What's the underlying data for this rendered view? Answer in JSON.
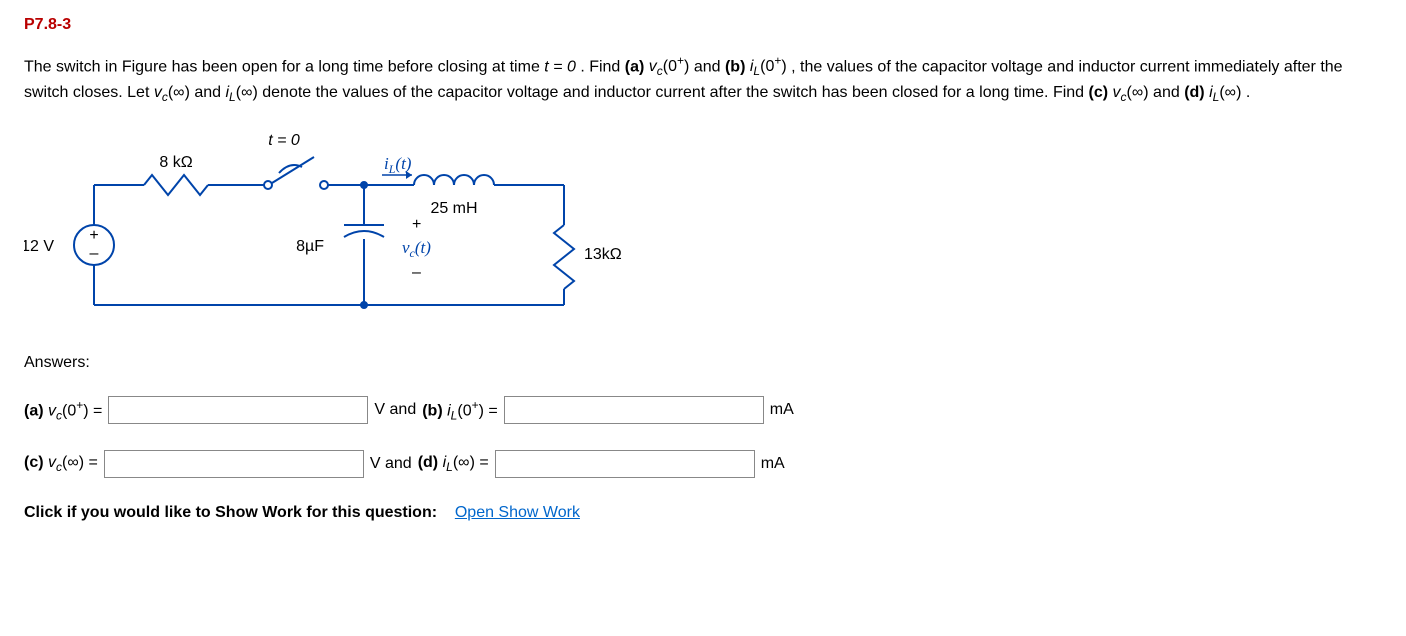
{
  "problem": {
    "number": "P7.8-3",
    "text_parts": {
      "p1": "The switch in Figure has been open for a long time before closing at time ",
      "eq_t": "t = 0",
      "p2": ". Find ",
      "p3": " and ",
      "p4": ", the values of the capacitor voltage and inductor current immediately after the switch closes. Let ",
      "p5": " denote the values of the capacitor voltage and inductor current after the switch has been closed for a long time. Find ",
      "p6": " and ",
      "p7": "."
    },
    "labels": {
      "a": "(a)",
      "b": "(b)",
      "c": "(c)",
      "d": "(d)",
      "vc0": "v",
      "vc0_sub": "c",
      "vc0_arg": "(0",
      "plus": "+",
      "close": ")",
      "iL": "i",
      "iL_sub": "L",
      "inf_arg": "(∞)"
    }
  },
  "figure": {
    "t0": "t = 0",
    "r1": "8 kΩ",
    "cap": "8µF",
    "ind": "25 mH",
    "r2": "13kΩ",
    "vsrc": "12 V",
    "iL": "i",
    "iL_sub": "L",
    "iL_arg": "(t)",
    "vc": "v",
    "vc_sub": "c",
    "vc_arg": "(t)",
    "plus": "+",
    "minus": "–"
  },
  "answers": {
    "header": "Answers:",
    "unit_V": "V",
    "unit_mA": "mA",
    "and": "and",
    "eq": " = "
  },
  "show_work": {
    "label": "Click if you would like to Show Work for this question:",
    "link": "Open Show Work"
  }
}
